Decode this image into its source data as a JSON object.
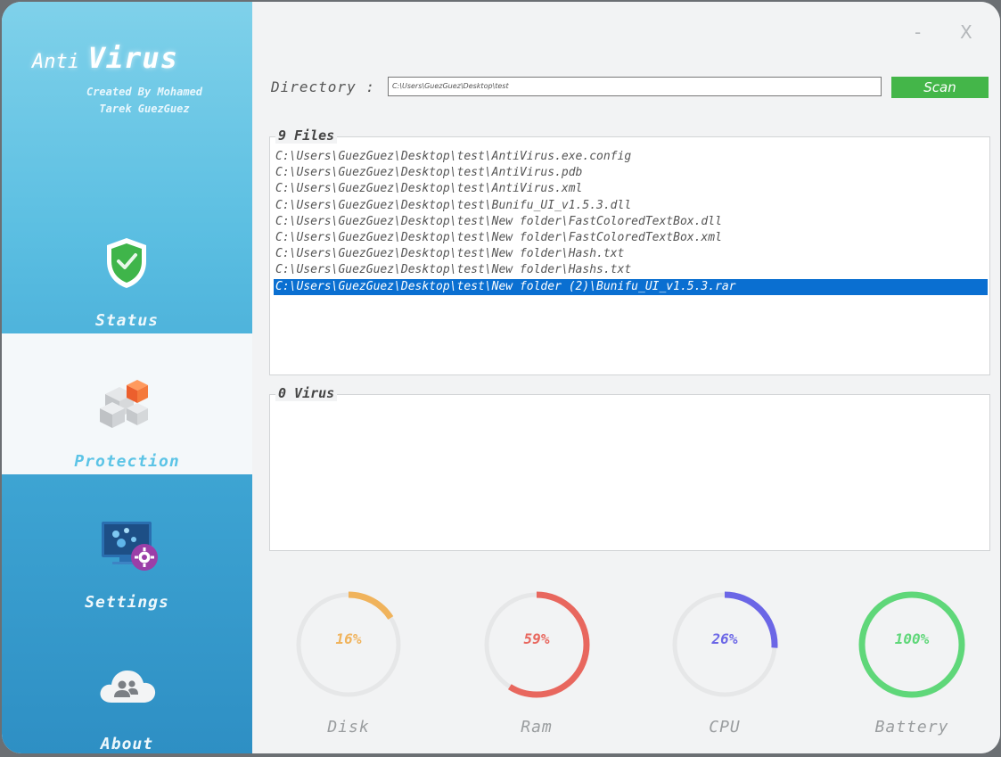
{
  "app": {
    "brand_anti": "Anti",
    "brand_virus": "Virus",
    "credit_line1": "Created By Mohamed",
    "credit_line2": "Tarek GuezGuez"
  },
  "sidebar": {
    "items": [
      {
        "label": "Status",
        "icon": "shield-icon",
        "active": false
      },
      {
        "label": "Protection",
        "icon": "cubes-icon",
        "active": true
      },
      {
        "label": "Settings",
        "icon": "monitor-gear-icon",
        "active": false
      },
      {
        "label": "About",
        "icon": "users-cloud-icon",
        "active": false
      }
    ]
  },
  "window": {
    "minimize": "-",
    "close": "X"
  },
  "directory": {
    "label": "Directory :",
    "value": "C:\\Users\\GuezGuez\\Desktop\\test",
    "scan_label": "Scan"
  },
  "files": {
    "title": "9 Files",
    "items": [
      "C:\\Users\\GuezGuez\\Desktop\\test\\AntiVirus.exe.config",
      "C:\\Users\\GuezGuez\\Desktop\\test\\AntiVirus.pdb",
      "C:\\Users\\GuezGuez\\Desktop\\test\\AntiVirus.xml",
      "C:\\Users\\GuezGuez\\Desktop\\test\\Bunifu_UI_v1.5.3.dll",
      "C:\\Users\\GuezGuez\\Desktop\\test\\New folder\\FastColoredTextBox.dll",
      "C:\\Users\\GuezGuez\\Desktop\\test\\New folder\\FastColoredTextBox.xml",
      "C:\\Users\\GuezGuez\\Desktop\\test\\New folder\\Hash.txt",
      "C:\\Users\\GuezGuez\\Desktop\\test\\New folder\\Hashs.txt",
      "C:\\Users\\GuezGuez\\Desktop\\test\\New folder (2)\\Bunifu_UI_v1.5.3.rar"
    ],
    "selected_index": 8
  },
  "virus": {
    "title": "0 Virus"
  },
  "gauges": [
    {
      "label": "Disk",
      "value_text": "16%",
      "fraction": 0.16,
      "color": "#f0b35c"
    },
    {
      "label": "Ram",
      "value_text": "59%",
      "fraction": 0.59,
      "color": "#e8675e"
    },
    {
      "label": "CPU",
      "value_text": "26%",
      "fraction": 0.26,
      "color": "#6b66e6"
    },
    {
      "label": "Battery",
      "value_text": "100%",
      "fraction": 1.0,
      "color": "#5fd779"
    }
  ],
  "colors": {
    "scan": "#44b649",
    "selection": "#0a6fd1",
    "sidebar_top": "#7fd1ea",
    "sidebar_bottom": "#2e8fc4",
    "active_label": "#5cc4e6"
  }
}
